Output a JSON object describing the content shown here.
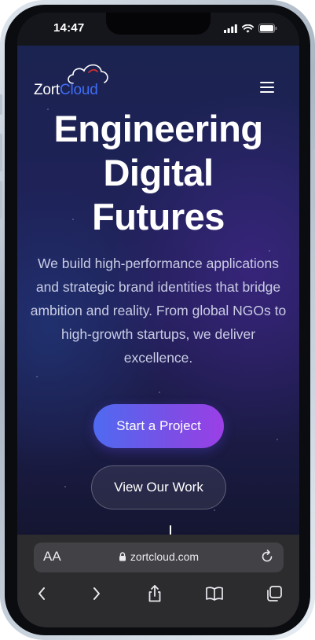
{
  "status_bar": {
    "time": "14:47"
  },
  "site": {
    "logo": {
      "prefix": "Zort",
      "accent": "Cloud"
    },
    "menu_icon": "hamburger-icon",
    "hero": {
      "headline_lines": [
        "Engineering",
        "Digital",
        "Futures"
      ],
      "subtext": "We build high-performance applications and strategic brand identities that bridge ambition and reality. From global NGOs to high-growth startups, we deliver excellence.",
      "primary_cta": "Start a Project",
      "secondary_cta": "View Our Work"
    }
  },
  "browser": {
    "reader_label": "AA",
    "url": "zortcloud.com",
    "toolbar_icons": [
      "back-icon",
      "forward-icon",
      "share-icon",
      "bookmarks-icon",
      "tabs-icon"
    ]
  },
  "colors": {
    "logo_accent": "#3f6df5",
    "cta_gradient_start": "#4f6af0",
    "cta_gradient_end": "#9b3fe6",
    "hero_bg": "#1e2257",
    "safari_bar": "#2c2c2f"
  }
}
